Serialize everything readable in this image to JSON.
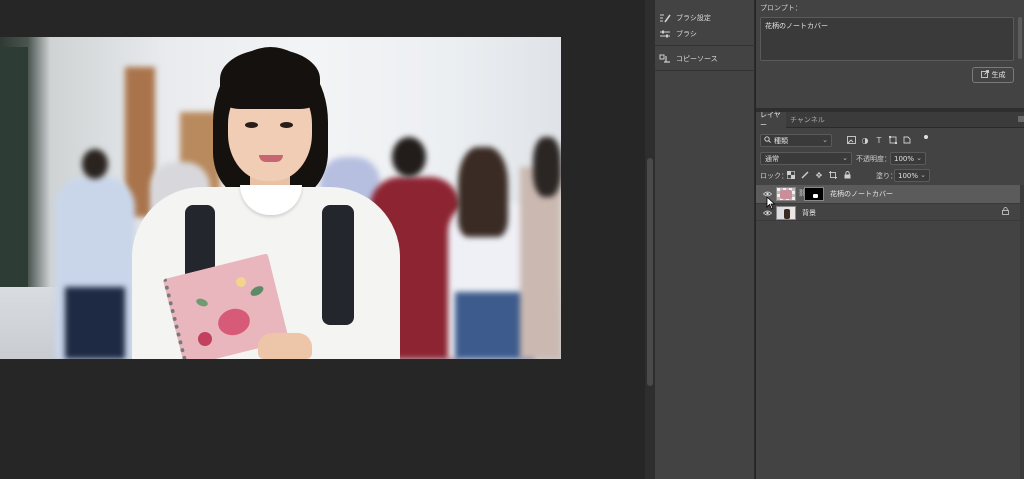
{
  "properties": {
    "prompt_label": "プロンプト：",
    "prompt_text": "花柄のノートカバー",
    "generate_label": "生成"
  },
  "mid_panel": {
    "items": [
      {
        "label": "ブラシ設定",
        "icon": "brush-settings-icon"
      },
      {
        "label": "ブラシ",
        "icon": "brush-sliders-icon"
      },
      {
        "label": "コピーソース",
        "icon": "clone-source-icon"
      }
    ]
  },
  "layers_panel": {
    "tabs": [
      {
        "label": "レイヤー",
        "active": true
      },
      {
        "label": "チャンネル",
        "active": false
      }
    ],
    "filter_kind": "種類",
    "blend_mode": "通常",
    "opacity_label": "不透明度：",
    "opacity_value": "100%",
    "lock_label": "ロック：",
    "fill_label": "塗り：",
    "fill_value": "100%",
    "layers": [
      {
        "name": "花柄のノートカバー",
        "selected": true,
        "visible": true
      },
      {
        "name": "背景",
        "selected": false,
        "visible": true,
        "locked": true
      }
    ]
  },
  "colors": {
    "canvas_bg": "#262626",
    "panel_bg": "#434343",
    "selected_layer": "#5b5b5b"
  }
}
